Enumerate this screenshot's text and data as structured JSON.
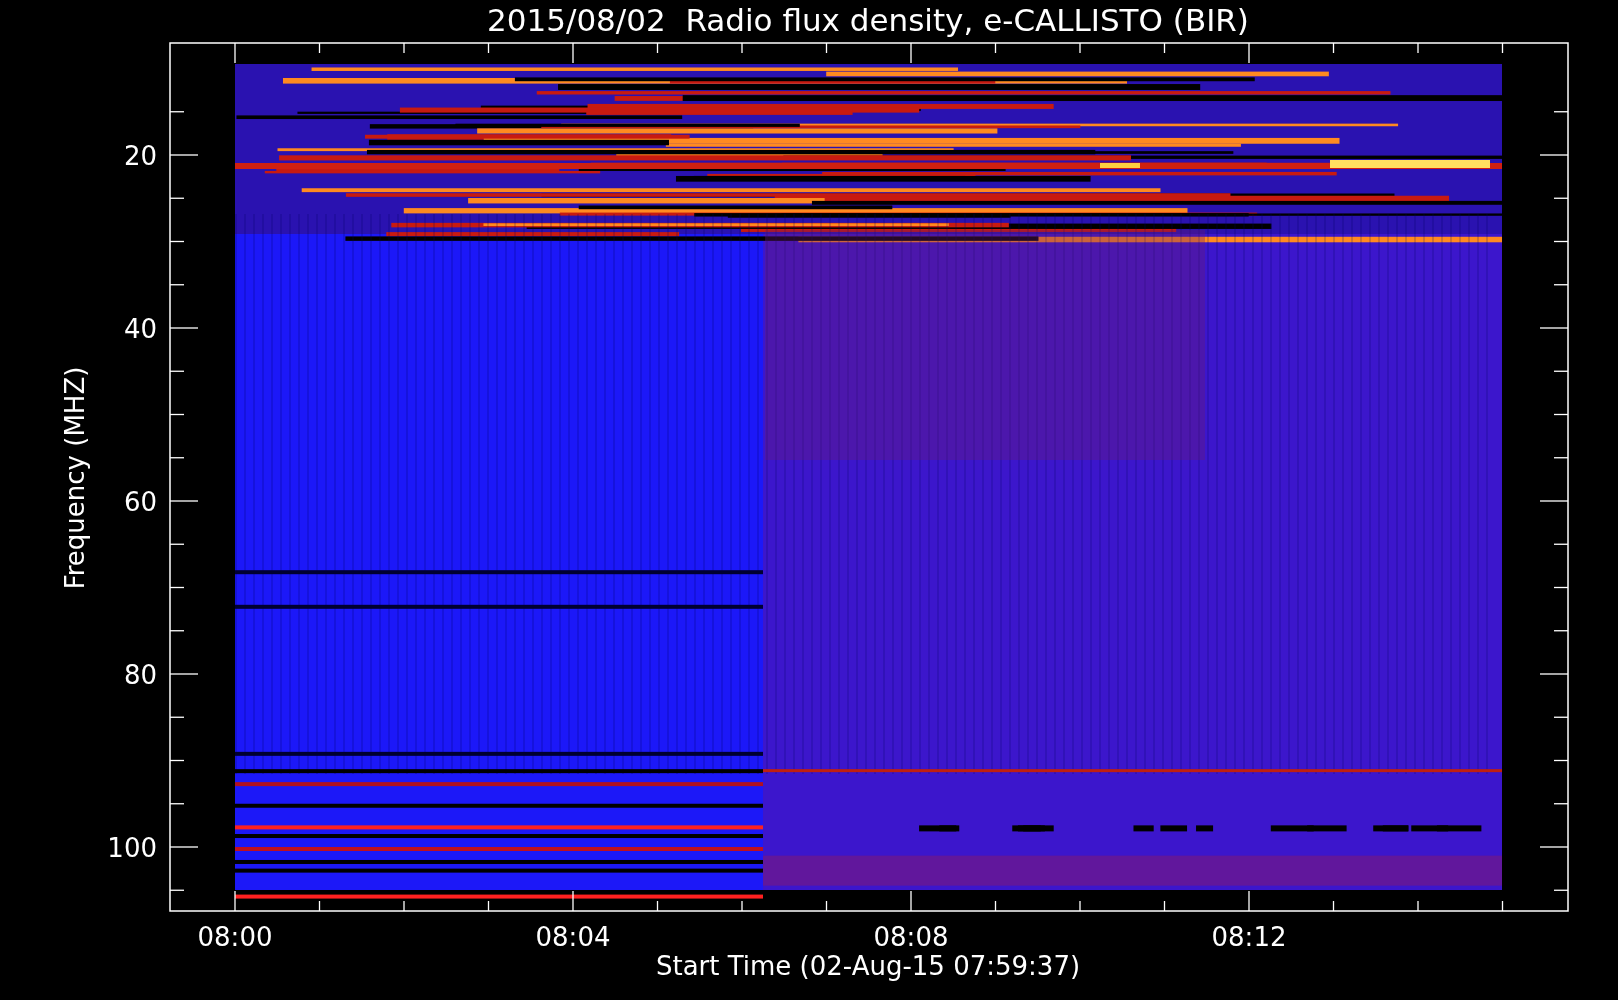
{
  "title": "2015/08/02  Radio flux density, e-CALLISTO (BIR)",
  "ylabel": "Frequency (MHZ)",
  "xlabel": "Start Time (02-Aug-15 07:59:37)",
  "yticks": [
    "20",
    "40",
    "60",
    "80",
    "100"
  ],
  "xticks": [
    "08:00",
    "08:04",
    "08:08",
    "08:12"
  ]
}
